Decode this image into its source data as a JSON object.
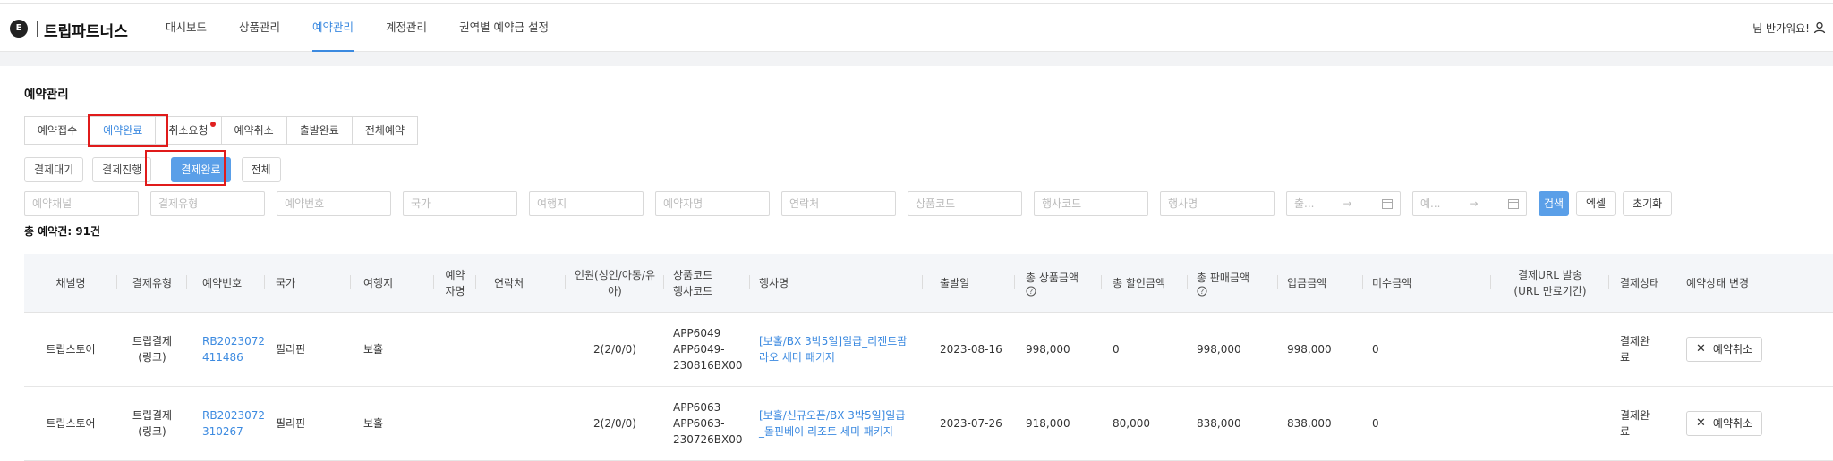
{
  "header": {
    "logo_letter": "E",
    "brand": "트립파트너스",
    "nav": [
      {
        "label": "대시보드"
      },
      {
        "label": "상품관리"
      },
      {
        "label": "예약관리"
      },
      {
        "label": "계정관리"
      },
      {
        "label": "권역별 예약금 설정"
      }
    ],
    "greeting": "님 반가워요!",
    "icon": "user-icon"
  },
  "page": {
    "title": "예약관리",
    "tabs": [
      {
        "label": "예약접수"
      },
      {
        "label": "예약완료"
      },
      {
        "label": "취소요청"
      },
      {
        "label": "예약취소"
      },
      {
        "label": "출발완료"
      },
      {
        "label": "전체예약"
      }
    ],
    "subtabs": [
      {
        "label": "결제대기"
      },
      {
        "label": "결제진행"
      },
      {
        "label": "결제완료"
      },
      {
        "label": "전체"
      }
    ],
    "filters": {
      "channel": "예약채널",
      "payment_type": "결제유형",
      "booking_no": "예약번호",
      "country": "국가",
      "destination": "여행지",
      "booker": "예약자명",
      "contact": "연락처",
      "product_code": "상품코드",
      "event_code": "행사코드",
      "event_name": "행사명",
      "date1_start": "출...",
      "date2_start": "예...",
      "date_arrow": "→"
    },
    "buttons": {
      "search": "검색",
      "excel": "엑셀",
      "reset": "초기화"
    },
    "total": "총 예약건: 91건",
    "colors": {
      "accent": "#3c8ae0",
      "active_fill": "#5a9fe8",
      "highlight": "#e01b1b",
      "badge": "#e02020"
    }
  },
  "table": {
    "headers": {
      "channel": "채널명",
      "payment_type": "결제유형",
      "booking_no": "예약번호",
      "country": "국가",
      "destination": "여행지",
      "booker": "예약자명",
      "contact": "연락처",
      "pax": "인원(성인/아동/유아)",
      "code": "상품코드\n행사코드",
      "event_name": "행사명",
      "departure": "출발일",
      "total_product": "총 상품금액",
      "total_discount": "총 할인금액",
      "total_sales": "총 판매금액",
      "deposit": "입금금액",
      "unpaid": "미수금액",
      "url_sent": "결제URL 발송",
      "url_sub": "(URL 만료기간)",
      "pay_status": "결제상태",
      "change_status": "예약상태 변경"
    },
    "rows": [
      {
        "channel": "트립스토어",
        "payment_type": "트립결제\n(링크)",
        "booking_no": "RB2023072\n411486",
        "country": "필리핀",
        "destination": "보홀",
        "booker": "",
        "contact": "",
        "pax": "2(2/0/0)",
        "code": "APP6049\nAPP6049-\n230816BX00",
        "event_name": "[보홀/BX 3박5일]일급_리젠트팜\n라오 세미 패키지",
        "departure": "2023-08-16",
        "total_product": "998,000",
        "total_discount": "0",
        "total_sales": "998,000",
        "deposit": "998,000",
        "unpaid": "0",
        "url_sent": "",
        "pay_status": "결제완\n료",
        "action": "예약취소"
      },
      {
        "channel": "트립스토어",
        "payment_type": "트립결제\n(링크)",
        "booking_no": "RB2023072\n310267",
        "country": "필리핀",
        "destination": "보홀",
        "booker": "",
        "contact": "",
        "pax": "2(2/0/0)",
        "code": "APP6063\nAPP6063-\n230726BX00",
        "event_name": "[보홀/신규오픈/BX 3박5일]일급\n_돌핀베이 리조트 세미 패키지",
        "departure": "2023-07-26",
        "total_product": "918,000",
        "total_discount": "80,000",
        "total_sales": "838,000",
        "deposit": "838,000",
        "unpaid": "0",
        "url_sent": "",
        "pay_status": "결제완\n료",
        "action": "예약취소"
      }
    ]
  }
}
